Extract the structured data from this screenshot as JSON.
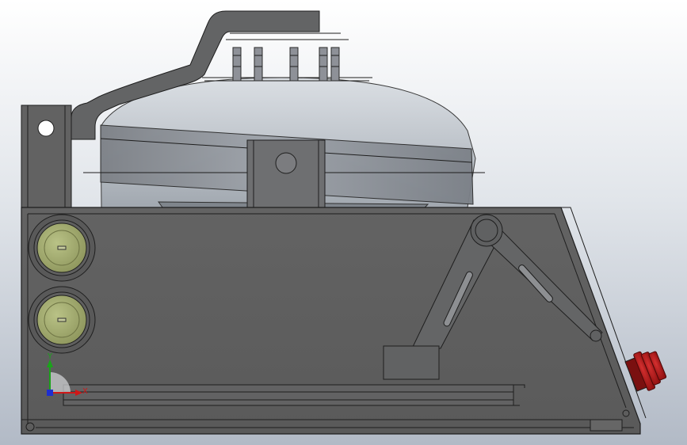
{
  "viewport": {
    "background_top": "#ffffff",
    "background_bottom": "#b2bac6"
  },
  "model": {
    "body_color": "#5f5f5f",
    "hopper_color": "#8a8f96",
    "knob_color": "#a7b073",
    "red_plug_color": "#b81b1b",
    "edge_color": "#1e1e1e"
  },
  "triad": {
    "y_label": "Y",
    "x_label": "X",
    "y_color": "#1aa31a",
    "x_color": "#d01818",
    "z_color": "#1e2fd0"
  }
}
